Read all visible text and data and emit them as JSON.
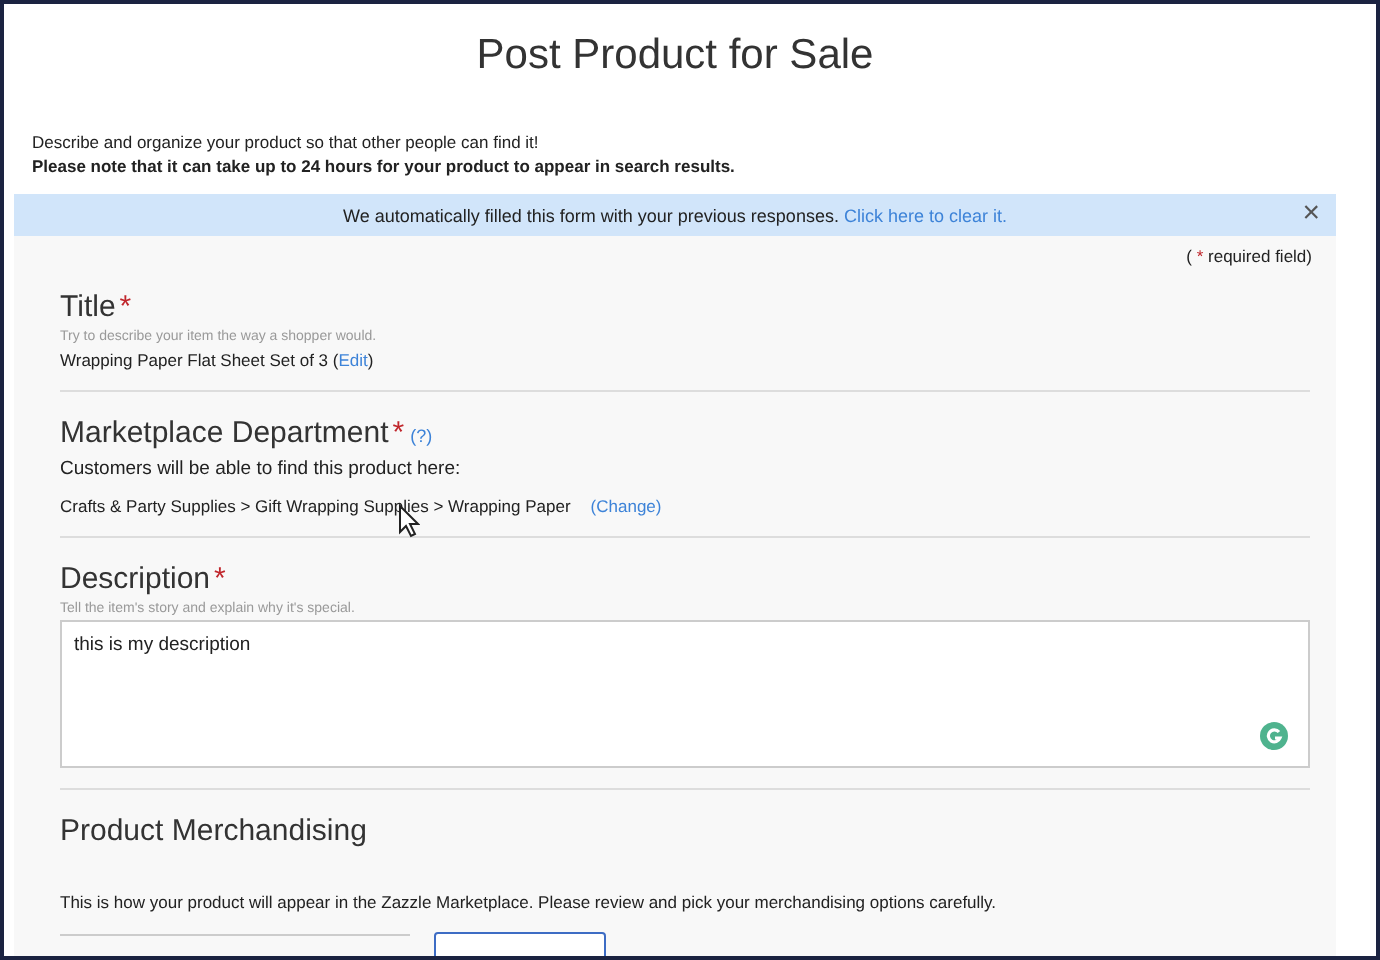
{
  "page_title": "Post Product for Sale",
  "intro": {
    "line": "Describe and organize your product so that other people can find it!",
    "note": "Please note that it can take up to 24 hours for your product to appear in search results."
  },
  "banner": {
    "message": "We automatically filled this form with your previous responses.",
    "link": "Click here to clear it.",
    "close": "×"
  },
  "required_note": {
    "open": "(",
    "star": "*",
    "text": "required field)"
  },
  "sections": [
    {
      "kind": "value",
      "label": "Title",
      "required": true,
      "hint": "Try to describe your item the way a shopper would.",
      "value": "Wrapping Paper Flat Sheet Set of 3",
      "link_open": "(",
      "link": "Edit",
      "link_close": ")"
    },
    {
      "kind": "department",
      "label": "Marketplace Department",
      "required": true,
      "help": "(?)",
      "subtitle": "Customers will be able to find this product here:",
      "path": "Crafts & Party Supplies > Gift Wrapping Supplies > Wrapping Paper",
      "link": "(Change)"
    },
    {
      "kind": "textarea",
      "label": "Description",
      "required": true,
      "hint": "Tell the item's story and explain why it's special.",
      "value": "this is my description"
    },
    {
      "kind": "text",
      "label": "Product Merchandising",
      "required": false,
      "text": "This is how your product will appear in the Zazzle Marketplace. Please review and pick your merchandising options carefully."
    }
  ]
}
